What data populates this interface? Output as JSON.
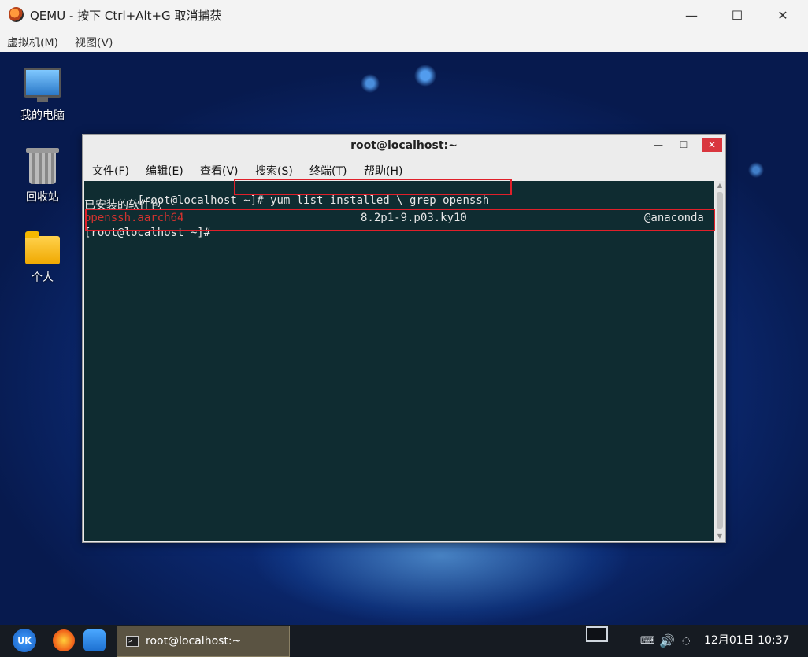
{
  "host_window": {
    "title": "QEMU - 按下 Ctrl+Alt+G 取消捕获",
    "minimize": "—",
    "maximize": "☐",
    "close": "✕",
    "menus": [
      "虚拟机(M)",
      "视图(V)"
    ]
  },
  "desktop": {
    "icons": [
      {
        "label": "我的电脑",
        "icon": "computer-icon"
      },
      {
        "label": "回收站",
        "icon": "trash-icon"
      },
      {
        "label": "个人",
        "icon": "home-folder-icon"
      }
    ]
  },
  "terminal": {
    "title": "root@localhost:~",
    "minimize": "—",
    "maximize": "☐",
    "close": "✕",
    "menus": [
      "文件(F)",
      "编辑(E)",
      "查看(V)",
      "搜索(S)",
      "终端(T)",
      "帮助(H)"
    ],
    "prompt": "[root@localhost ~]#",
    "command": " yum list installed \\ grep openssh",
    "installed_header": "已安装的软件包",
    "package": {
      "name": "openssh.aarch64",
      "version": "8.2p1-9.p03.ky10",
      "repo": "@anaconda"
    },
    "prompt2": "[root@localhost ~]#",
    "colors": {
      "background": "#0f2c31",
      "package_name": "#d2332f",
      "text": "#e8e8e8",
      "highlight": "#e0202a"
    }
  },
  "taskbar": {
    "start": "UK",
    "task_label": "root@localhost:~",
    "task_icon": ">_",
    "tray": {
      "keyboard": "⌨",
      "volume": "🔊",
      "network": "◌",
      "clock": "12月01日 10:37"
    }
  }
}
